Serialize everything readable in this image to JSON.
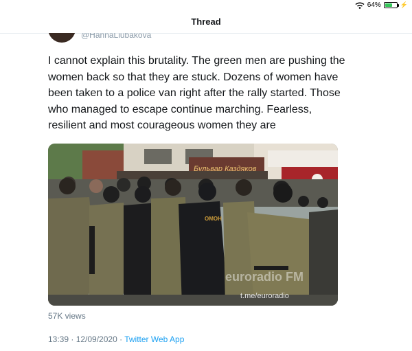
{
  "status_bar": {
    "battery_text": "64%",
    "battery_level": 0.64
  },
  "nav": {
    "title": "Thread"
  },
  "author": {
    "handle": "@HannaLiubakova"
  },
  "tweet": {
    "text": "I cannot explain this brutality. The green men are pushing the women back so that they are stuck. Dozens of women have been taken to a police van right after the rally started. Those who managed to escape continue marching. Fearless, resilient and most courageous women they are",
    "views": "57K views",
    "date": "13:39 · 12/09/2020",
    "separator": " · ",
    "source": "Twitter Web App"
  },
  "media": {
    "watermark_logo": "euroradio FM",
    "watermark_url": "t.me/euroradio",
    "uniform_label": "ОМОН",
    "storefront_sign": "Бульвар Каздяков"
  },
  "colors": {
    "link": "#1da1f2",
    "secondary_text": "#657786",
    "battery": "#34c759"
  }
}
